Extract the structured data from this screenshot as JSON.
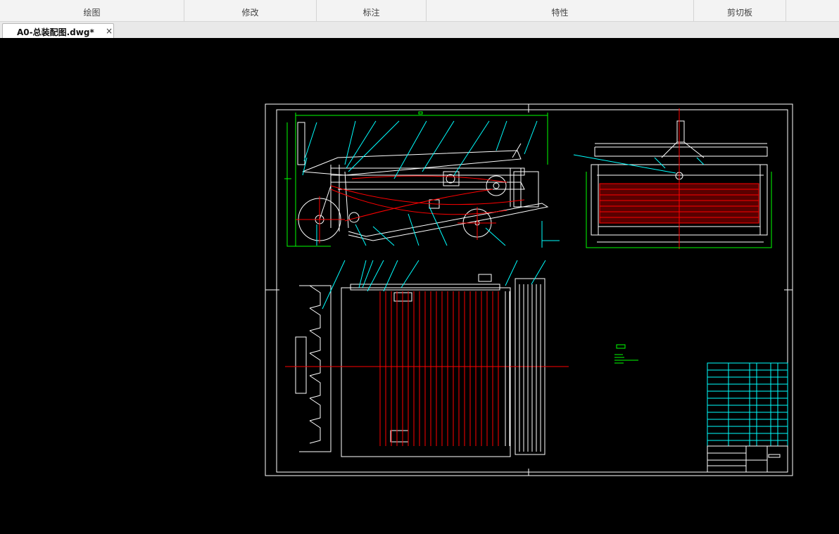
{
  "ribbon": {
    "groups": [
      {
        "id": "draw",
        "label": "绘图"
      },
      {
        "id": "modify",
        "label": "修改"
      },
      {
        "id": "annotate",
        "label": "标注"
      },
      {
        "id": "properties",
        "label": "特性"
      },
      {
        "id": "clipboard",
        "label": "剪切板"
      }
    ]
  },
  "tabs": [
    {
      "title": "A0-总装配图.dwg*",
      "close": "×",
      "active": true
    }
  ],
  "colors": {
    "canvas_bg": "#000000",
    "frame": "#ffffff",
    "dimension": "#00ff00",
    "leader": "#00ffff",
    "part": "#ff0000",
    "ribbon_bg": "#f3f3f3"
  }
}
